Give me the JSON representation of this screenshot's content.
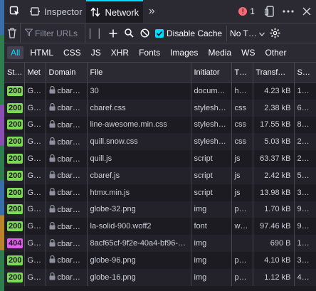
{
  "tabs": [
    {
      "label": "Inspector"
    },
    {
      "label": "Network"
    }
  ],
  "errors": {
    "count": "1"
  },
  "filter": {
    "placeholder": "Filter URLs"
  },
  "options": {
    "disable_cache": "Disable Cache",
    "throttle": "No T…"
  },
  "types": [
    "All",
    "HTML",
    "CSS",
    "JS",
    "XHR",
    "Fonts",
    "Images",
    "Media",
    "WS",
    "Other"
  ],
  "columns": [
    "St…",
    "Met",
    "Domain",
    "File",
    "Initiator",
    "T…",
    "Transf…",
    "S…"
  ],
  "colors": {
    "ok": "#7ed957",
    "notfound": "#e35dec",
    "accent": "#00ddff"
  },
  "rows": [
    {
      "status": "200",
      "method": "G…",
      "domain": "cbar…",
      "file": "30",
      "initiator": "docum…",
      "type": "h…",
      "transferred": "4.23 kB",
      "size": "1…"
    },
    {
      "status": "200",
      "method": "G…",
      "domain": "cbar…",
      "file": "cbaref.css",
      "initiator": "stylesh…",
      "type": "css",
      "transferred": "2.38 kB",
      "size": "6…"
    },
    {
      "status": "200",
      "method": "G…",
      "domain": "cbar…",
      "file": "line-awesome.min.css",
      "initiator": "stylesh…",
      "type": "css",
      "transferred": "17.55 kB",
      "size": "8…"
    },
    {
      "status": "200",
      "method": "G…",
      "domain": "cbar…",
      "file": "quill.snow.css",
      "initiator": "stylesh…",
      "type": "css",
      "transferred": "5.03 kB",
      "size": "2…"
    },
    {
      "status": "200",
      "method": "G…",
      "domain": "cbar…",
      "file": "quill.js",
      "initiator": "script",
      "type": "js",
      "transferred": "63.37 kB",
      "size": "2…"
    },
    {
      "status": "200",
      "method": "G…",
      "domain": "cbar…",
      "file": "cbaref.js",
      "initiator": "script",
      "type": "js",
      "transferred": "2.42 kB",
      "size": "5…"
    },
    {
      "status": "200",
      "method": "G…",
      "domain": "cbar…",
      "file": "htmx.min.js",
      "initiator": "script",
      "type": "js",
      "transferred": "13.98 kB",
      "size": "3…"
    },
    {
      "status": "200",
      "method": "G…",
      "domain": "cbar…",
      "file": "globe-32.png",
      "initiator": "img",
      "type": "p…",
      "transferred": "1.70 kB",
      "size": "9…"
    },
    {
      "status": "200",
      "method": "G…",
      "domain": "cbar…",
      "file": "la-solid-900.woff2",
      "initiator": "font",
      "type": "w…",
      "transferred": "97.46 kB",
      "size": "9…"
    },
    {
      "status": "404",
      "method": "G…",
      "domain": "cbar…",
      "file": "8acf65cf-9f2e-40a4-bf96-…",
      "initiator": "img",
      "type": "",
      "transferred": "690 B",
      "size": "1…"
    },
    {
      "status": "200",
      "method": "G…",
      "domain": "cbar…",
      "file": "globe-96.png",
      "initiator": "img",
      "type": "p…",
      "transferred": "4.10 kB",
      "size": "3…"
    },
    {
      "status": "200",
      "method": "G…",
      "domain": "cbar…",
      "file": "globe-16.png",
      "initiator": "img",
      "type": "p…",
      "transferred": "1.12 kB",
      "size": "4…"
    }
  ]
}
